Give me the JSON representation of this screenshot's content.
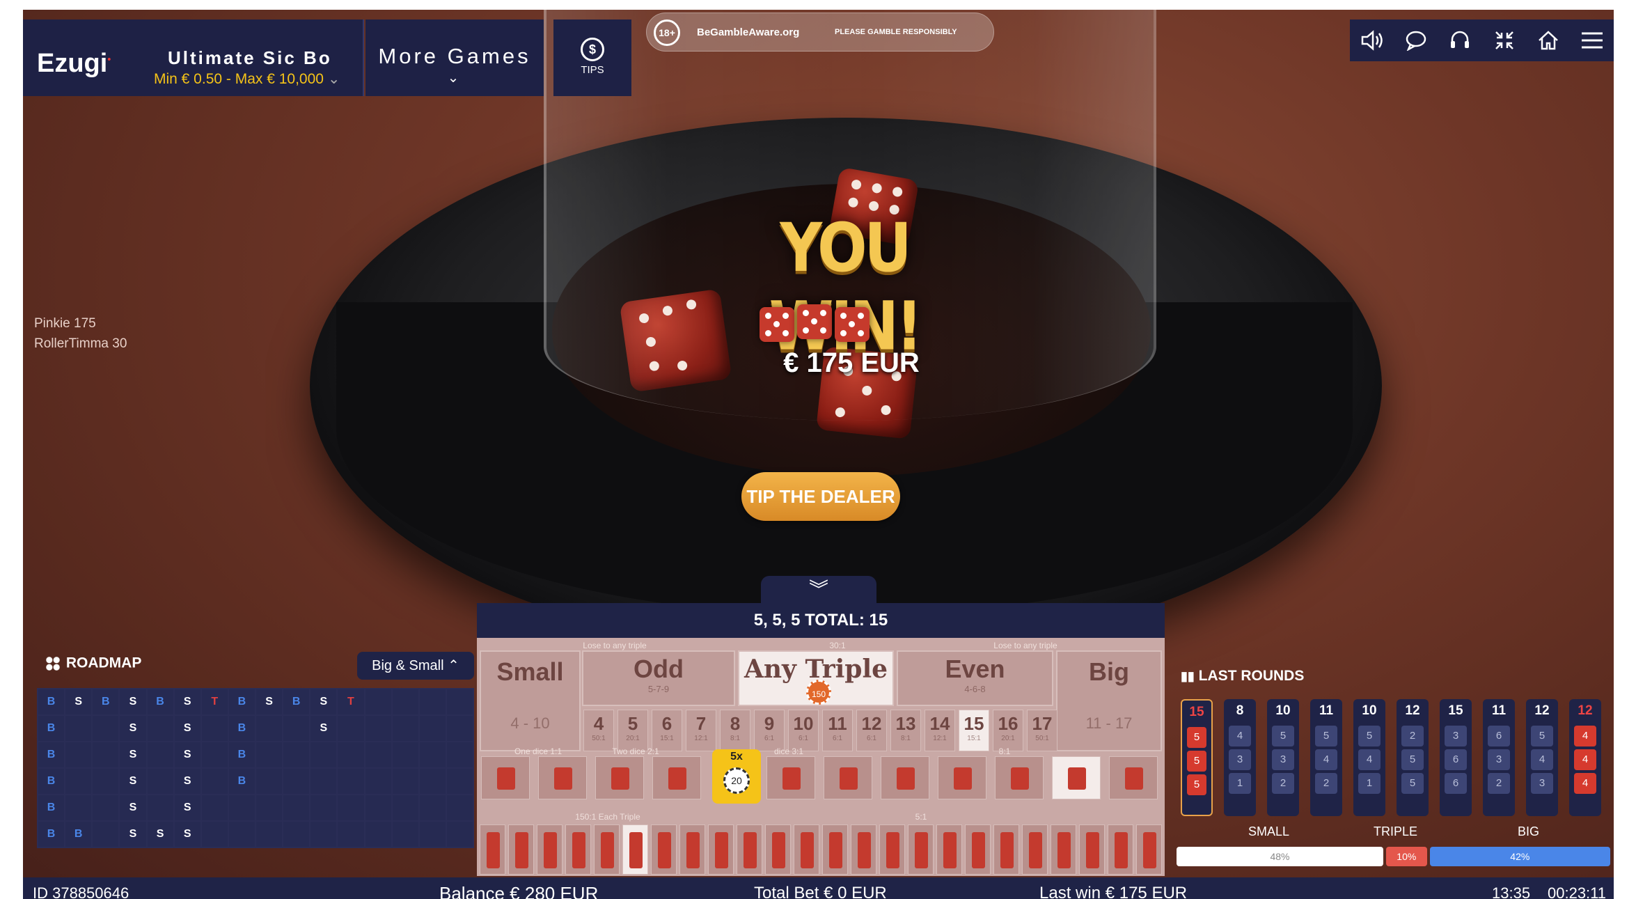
{
  "header": {
    "logo": "Ezugi",
    "game_title": "Ultimate Sic Bo",
    "limits": "Min € 0.50 - Max € 10,000",
    "more_games": "More Games",
    "tips": "TIPS",
    "age_badge": "18+",
    "gamble_aware": "BeGambleAware.org",
    "responsibly": "PLEASE GAMBLE RESPONSIBLY"
  },
  "toolbar": {
    "icons": [
      "sound-icon",
      "chat-icon",
      "headset-icon",
      "collapse-icon",
      "home-icon",
      "menu-icon"
    ]
  },
  "chat": [
    {
      "user": "Pinkie",
      "amount": "175"
    },
    {
      "user": "RollerTimma",
      "amount": "30"
    }
  ],
  "win": {
    "title": "YOU WIN!",
    "amount": "€ 175 EUR"
  },
  "tip_button": "TIP THE DEALER",
  "result": "5, 5, 5 TOTAL: 15",
  "board": {
    "small": {
      "label": "Small",
      "range": "4 - 10",
      "note": "Lose to any triple"
    },
    "odd": {
      "label": "Odd",
      "sub": "5-7-9"
    },
    "any_triple": {
      "label": "Any Triple",
      "payout": "30:1",
      "chip": "150"
    },
    "even": {
      "label": "Even",
      "sub": "4-6-8"
    },
    "big": {
      "label": "Big",
      "range": "11 - 17",
      "note": "Lose to any triple"
    },
    "totals": [
      {
        "n": "4",
        "p": "50:1"
      },
      {
        "n": "5",
        "p": "20:1"
      },
      {
        "n": "6",
        "p": "15:1"
      },
      {
        "n": "7",
        "p": "12:1"
      },
      {
        "n": "8",
        "p": "8:1"
      },
      {
        "n": "9",
        "p": "6:1"
      },
      {
        "n": "10",
        "p": "6:1"
      },
      {
        "n": "11",
        "p": "6:1"
      },
      {
        "n": "12",
        "p": "6:1"
      },
      {
        "n": "13",
        "p": "8:1"
      },
      {
        "n": "14",
        "p": "12:1"
      },
      {
        "n": "15",
        "p": "15:1"
      },
      {
        "n": "16",
        "p": "20:1"
      },
      {
        "n": "17",
        "p": "50:1"
      }
    ],
    "row_labels": [
      "One dice 1:1",
      "Two dice 2:1",
      "dice 3:1",
      "8:1",
      "150:1 Each Triple",
      "5:1"
    ],
    "multiplier": "5x",
    "bet_chip": "20"
  },
  "roadmap": {
    "title": "ROADMAP",
    "toggle": "Big & Small",
    "grid": [
      [
        "B",
        "S",
        "B",
        "S",
        "B",
        "S",
        "T",
        "B",
        "S",
        "B",
        "S",
        "T",
        "",
        "",
        "",
        ""
      ],
      [
        "B",
        "",
        "",
        "S",
        "",
        "S",
        "",
        "B",
        "",
        "",
        "S",
        "",
        "",
        "",
        "",
        ""
      ],
      [
        "B",
        "",
        "",
        "S",
        "",
        "S",
        "",
        "B",
        "",
        "",
        "",
        "",
        "",
        "",
        "",
        ""
      ],
      [
        "B",
        "",
        "",
        "S",
        "",
        "S",
        "",
        "B",
        "",
        "",
        "",
        "",
        "",
        "",
        "",
        ""
      ],
      [
        "B",
        "",
        "",
        "S",
        "",
        "S",
        "",
        "",
        "",
        "",
        "",
        "",
        "",
        "",
        "",
        ""
      ],
      [
        "B",
        "B",
        "",
        "S",
        "S",
        "S",
        "",
        "",
        "",
        "",
        "",
        "",
        "",
        "",
        "",
        ""
      ]
    ]
  },
  "last_rounds": {
    "title": "LAST ROUNDS",
    "rounds": [
      {
        "total": "15",
        "dice": [
          "5",
          "5",
          "5"
        ],
        "triple": true
      },
      {
        "total": "8",
        "dice": [
          "4",
          "3",
          "1"
        ]
      },
      {
        "total": "10",
        "dice": [
          "5",
          "3",
          "2"
        ]
      },
      {
        "total": "11",
        "dice": [
          "5",
          "4",
          "2"
        ]
      },
      {
        "total": "10",
        "dice": [
          "5",
          "4",
          "1"
        ]
      },
      {
        "total": "12",
        "dice": [
          "2",
          "5",
          "5"
        ]
      },
      {
        "total": "15",
        "dice": [
          "3",
          "6",
          "6"
        ]
      },
      {
        "total": "11",
        "dice": [
          "6",
          "3",
          "2"
        ]
      },
      {
        "total": "12",
        "dice": [
          "5",
          "4",
          "3"
        ]
      },
      {
        "total": "12",
        "dice": [
          "4",
          "4",
          "4"
        ],
        "triple": true
      }
    ],
    "stats": {
      "small_label": "SMALL",
      "triple_label": "TRIPLE",
      "big_label": "BIG",
      "small": "48%",
      "triple": "10%",
      "big": "42%"
    }
  },
  "status": {
    "id": "ID 378850646",
    "balance": "Balance  € 280 EUR",
    "total_bet": "Total Bet € 0 EUR",
    "last_win": "Last win € 175 EUR",
    "clock": "13:35",
    "elapsed": "00:23:11"
  },
  "colors": {
    "navy": "#1f2347",
    "gold": "#f5c318",
    "red": "#c43a2e",
    "blue": "#4a86e8"
  }
}
